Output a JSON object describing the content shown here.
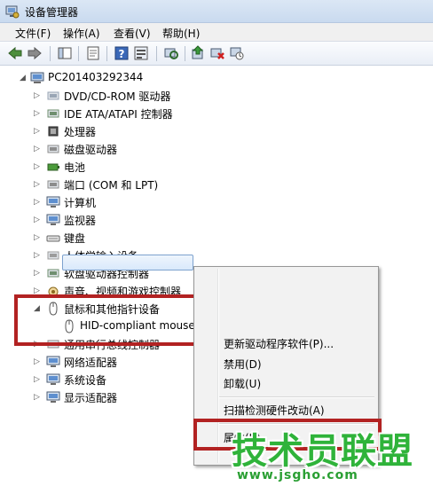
{
  "window": {
    "title": "设备管理器"
  },
  "menu": [
    {
      "label": "文件(F)"
    },
    {
      "label": "操作(A)"
    },
    {
      "label": "查看(V)"
    },
    {
      "label": "帮助(H)"
    }
  ],
  "toolbar": {
    "icons": [
      "back-arrow-icon",
      "forward-arrow-icon",
      "show-hide-console-tree-icon",
      "properties-icon",
      "help-icon",
      "view-icon",
      "update-driver-icon",
      "disable-device-icon",
      "uninstall-device-icon"
    ]
  },
  "tree": {
    "root": "PC201403292344",
    "items": [
      {
        "label": "DVD/CD-ROM 驱动器",
        "icon": "dvd-drive-icon"
      },
      {
        "label": "IDE ATA/ATAPI 控制器",
        "icon": "ide-controller-icon"
      },
      {
        "label": "处理器",
        "icon": "processor-icon"
      },
      {
        "label": "磁盘驱动器",
        "icon": "disk-drive-icon"
      },
      {
        "label": "电池",
        "icon": "battery-icon"
      },
      {
        "label": "端口 (COM 和 LPT)",
        "icon": "port-icon"
      },
      {
        "label": "计算机",
        "icon": "computer-icon"
      },
      {
        "label": "监视器",
        "icon": "monitor-icon"
      },
      {
        "label": "键盘",
        "icon": "keyboard-icon"
      },
      {
        "label": "人体学输入设备",
        "icon": "hid-icon"
      },
      {
        "label": "软盘驱动器控制器",
        "icon": "floppy-controller-icon"
      },
      {
        "label": "声音、视频和游戏控制器",
        "icon": "sound-icon"
      },
      {
        "label": "鼠标和其他指针设备",
        "icon": "mouse-icon"
      },
      {
        "label": "HID-compliant mouse",
        "icon": "mouse-icon"
      },
      {
        "label": "通用串行总线控制器",
        "icon": "usb-icon"
      },
      {
        "label": "网络适配器",
        "icon": "network-icon"
      },
      {
        "label": "系统设备",
        "icon": "system-device-icon"
      },
      {
        "label": "显示适配器",
        "icon": "display-adapter-icon"
      }
    ]
  },
  "context_menu": {
    "items": [
      {
        "label": "更新驱动程序软件(P)..."
      },
      {
        "label": "禁用(D)"
      },
      {
        "label": "卸载(U)"
      },
      {
        "label": "扫描检测硬件改动(A)"
      },
      {
        "label": "属性(R)"
      }
    ]
  },
  "watermark": {
    "text": "技术员联盟",
    "url": "www.jsgho.com"
  },
  "colors": {
    "highlight_box": "#b22222",
    "watermark": "#2fb33a"
  }
}
